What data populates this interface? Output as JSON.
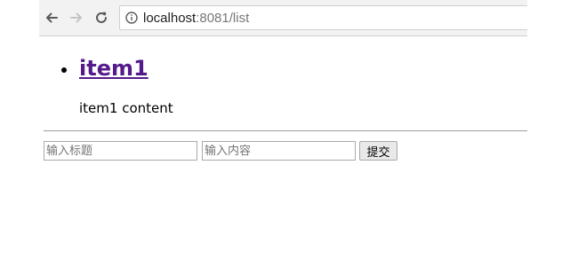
{
  "address_bar": {
    "host": "localhost",
    "port_path": ":8081/list"
  },
  "list": {
    "items": [
      {
        "title": "item1",
        "content": "item1 content"
      }
    ]
  },
  "form": {
    "title_placeholder": "输入标题",
    "content_placeholder": "输入内容",
    "submit_label": "提交"
  },
  "icons": {
    "back": "arrow-left-icon",
    "forward": "arrow-right-icon",
    "reload": "reload-icon",
    "site_info": "info-icon"
  },
  "colors": {
    "visited_link": "#551a8b"
  }
}
